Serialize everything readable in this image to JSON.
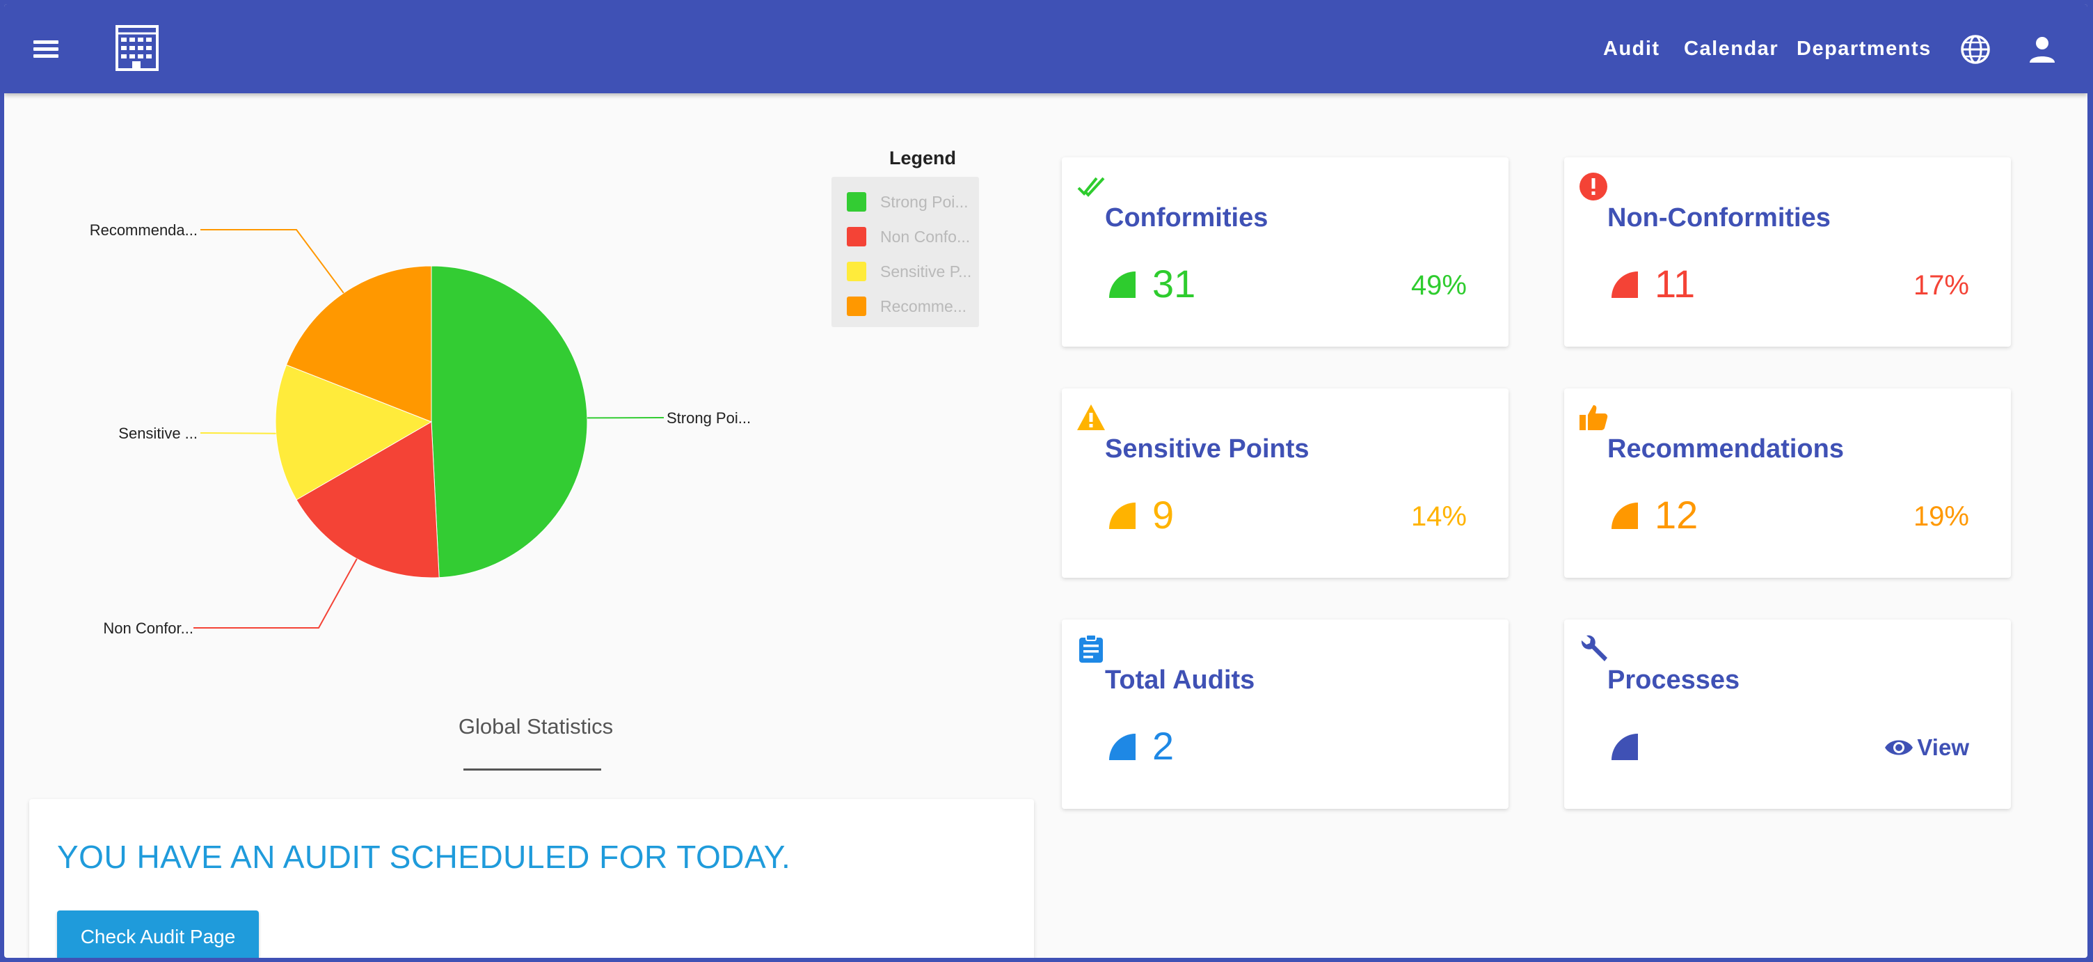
{
  "nav": {
    "links": [
      "Audit",
      "Calendar",
      "Departments"
    ]
  },
  "chart_data": {
    "type": "pie",
    "title": "Global Statistics",
    "legend_title": "Legend",
    "legend_position": "top-right",
    "categories": [
      "Strong Poi...",
      "Non Confor...",
      "Sensitive ...",
      "Recommenda..."
    ],
    "legend_labels": [
      "Strong Poi...",
      "Non Confo...",
      "Sensitive P...",
      "Recomme..."
    ],
    "values": [
      31,
      11,
      9,
      12
    ],
    "colors": [
      "#33cc33",
      "#f44336",
      "#ffeb3b",
      "#ff9800"
    ]
  },
  "cards": [
    {
      "title": "Conformities",
      "value": "31",
      "percent": "49%",
      "icon": "double-check-icon",
      "color": "#2ecc2e"
    },
    {
      "title": "Non-Conformities",
      "value": "11",
      "percent": "17%",
      "icon": "exclamation-circle-icon",
      "color": "#f44336"
    },
    {
      "title": "Sensitive Points",
      "value": "9",
      "percent": "14%",
      "icon": "warning-icon",
      "color": "#ffb300"
    },
    {
      "title": "Recommendations",
      "value": "12",
      "percent": "19%",
      "icon": "thumbs-up-icon",
      "color": "#ff9800"
    },
    {
      "title": "Total Audits",
      "value": "2",
      "icon": "clipboard-icon",
      "color": "#1e88e5"
    },
    {
      "title": "Processes",
      "view_label": "View",
      "icon": "wrench-icon",
      "color": "#3f51b5"
    }
  ],
  "alert": {
    "message": "YOU HAVE AN AUDIT SCHEDULED FOR TODAY.",
    "button_label": "Check Audit Page"
  }
}
